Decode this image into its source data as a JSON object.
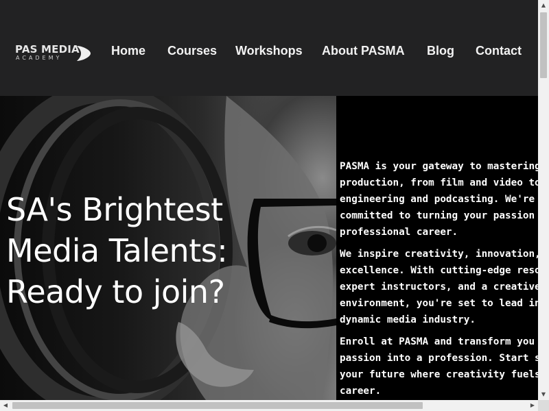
{
  "header": {
    "logo": {
      "name": "PAS MEDIA",
      "tagline": "ACADEMY"
    },
    "nav": [
      {
        "label": "Home"
      },
      {
        "label": "Courses"
      },
      {
        "label": "Workshops"
      },
      {
        "label": "About PASMA"
      },
      {
        "label": "Blog"
      },
      {
        "label": "Contact"
      }
    ]
  },
  "hero": {
    "title_lines": [
      "SA's Brightest",
      "Media Talents:",
      "Ready to join?"
    ],
    "image": "portrait-camera-glasses",
    "paragraphs": [
      [
        "PASMA is your gateway to mastering",
        "production, from film and video to",
        "engineering and podcasting. We're",
        "committed to turning your passion",
        "professional career."
      ],
      [
        "We inspire creativity, innovation, a",
        "excellence. With cutting-edge reso",
        "expert instructors, and a creative",
        "environment, you're set to lead in",
        "dynamic media industry."
      ],
      [
        "Enroll at PASMA and transform you",
        "passion into a profession. Start sha",
        "your future where creativity fuels y",
        "career."
      ]
    ]
  },
  "scrollbars": {
    "vertical_arrows": [
      "▲",
      "▼"
    ],
    "horizontal_arrows": [
      "◀",
      "▶"
    ]
  },
  "colors": {
    "header_bg": "#222223",
    "panel_bg": "#000000",
    "text": "#ffffff"
  }
}
